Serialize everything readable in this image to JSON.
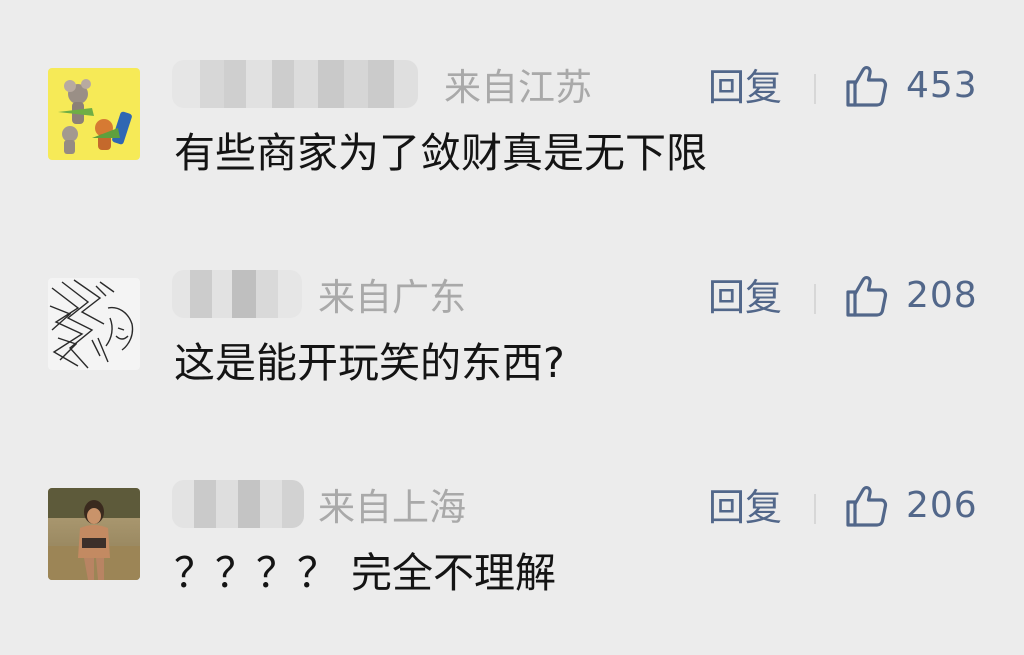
{
  "comments": [
    {
      "location": "来自江苏",
      "reply_label": "回复",
      "likes": "453",
      "text": "有些商家为了敛财真是无下限"
    },
    {
      "location": "来自广东",
      "reply_label": "回复",
      "likes": "208",
      "text": "这是能开玩笑的东西?"
    },
    {
      "location": "来自上海",
      "reply_label": "回复",
      "likes": "206",
      "text": "？？？？ 完全不理解"
    }
  ],
  "colors": {
    "background": "#ececec",
    "link_blue": "#52678a",
    "location_gray": "#a9a9a9",
    "text_dark": "#141414"
  },
  "icons": {
    "like": "thumbs-up-icon"
  }
}
